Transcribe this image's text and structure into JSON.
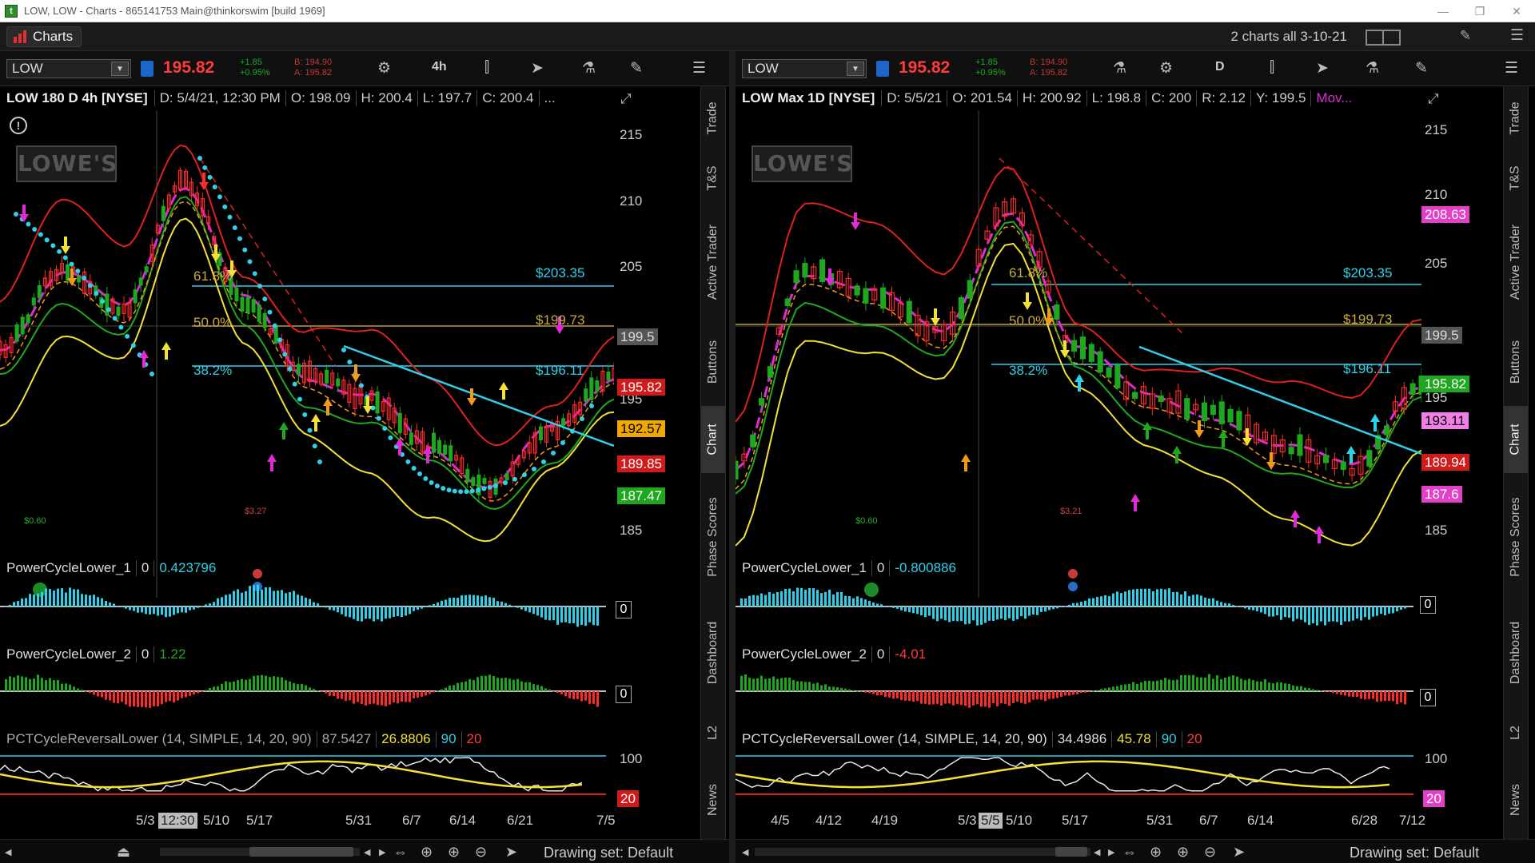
{
  "window": {
    "title": "LOW, LOW - Charts - 865141753 Main@thinkorswim [build 1969]",
    "minimize": "—",
    "restore": "❐",
    "close": "✕"
  },
  "app": {
    "tab_label": "Charts",
    "grid_title": "2 charts all 3-10-21",
    "pin_icon": "✎",
    "menu_icon": "☰"
  },
  "colors": {
    "bull": "#1fa81f",
    "bear": "#ff2a2a",
    "cyan": "#2fd0e8",
    "yellow": "#f3e133",
    "magenta": "#e02ad8",
    "orange": "#f39a1b",
    "fib": "#b8a13a"
  },
  "left": {
    "symbol": "LOW",
    "last_price": "195.82",
    "change_line1": "+1.85",
    "change_line2": "+0.95%",
    "bid": "B: 194.90",
    "ask": "A: 195.82",
    "aggregation": "4h",
    "header": {
      "name": "LOW 180 D 4h [NYSE]",
      "date": "D: 5/4/21, 12:30 PM",
      "open": "O: 198.09",
      "high": "H: 200.4",
      "low": "L: 197.7",
      "close": "C: 200.4",
      "more": "..."
    },
    "logo": "LOWE'S",
    "levels": [
      {
        "label": "$203.35",
        "color": "#2fd0e8"
      },
      {
        "label": "$199.73",
        "color": "#c9a93e"
      },
      {
        "label": "$196.11",
        "color": "#2fd0e8"
      }
    ],
    "fib_labels": [
      "61.8%",
      "50.0%",
      "38.2%"
    ],
    "yticks": [
      "215",
      "210",
      "205",
      "195",
      "185"
    ],
    "price_labels": [
      {
        "text": "199.5",
        "bg": "#555555",
        "fg": "#dddddd"
      },
      {
        "text": "195.82",
        "bg": "#d11a1a",
        "fg": "#ffffff"
      },
      {
        "text": "192.57",
        "bg": "#f0a800",
        "fg": "#000000"
      },
      {
        "text": "189.85",
        "bg": "#d11a1a",
        "fg": "#ffffff"
      },
      {
        "text": "187.47",
        "bg": "#1fa81f",
        "fg": "#ffffff"
      }
    ],
    "small_labels": [
      "$0.60",
      "$3.27"
    ],
    "studies": [
      {
        "name": "PowerCycleLower_1",
        "v1": "0",
        "v2": "0.423796",
        "v2_color": "#2fd0e8"
      },
      {
        "name": "PowerCycleLower_2",
        "v1": "0",
        "v2": "1.22",
        "v2_color": "#1fa81f"
      }
    ],
    "pct": {
      "name": "PCTCycleReversalLower (14, SIMPLE, 14, 20, 90)",
      "v1": "87.5427",
      "v2": "26.8806",
      "v3": "90",
      "v4": "20"
    },
    "pct_ticks": [
      "100",
      "20"
    ],
    "zero_label": "0",
    "xlabels": [
      "5/3",
      "5/10",
      "5/17",
      "5/31",
      "6/7",
      "6/14",
      "6/21",
      "7/5"
    ],
    "x_cursor": "12:30",
    "drawing_set": "Drawing set: Default"
  },
  "right": {
    "symbol": "LOW",
    "last_price": "195.82",
    "change_line1": "+1.85",
    "change_line2": "+0.95%",
    "bid": "B: 194.90",
    "ask": "A: 195.82",
    "aggregation": "D",
    "header": {
      "name": "LOW Max 1D [NYSE]",
      "date": "D: 5/5/21",
      "open": "O: 201.54",
      "high": "H: 200.92",
      "low": "L: 198.8",
      "close": "C: 200",
      "range": "R: 2.12",
      "y": "Y: 199.5",
      "mov": "Mov..."
    },
    "logo": "LOWE'S",
    "levels": [
      {
        "label": "$203.35",
        "color": "#2fd0e8"
      },
      {
        "label": "$199.73",
        "color": "#c9a93e"
      },
      {
        "label": "$196.11",
        "color": "#2fd0e8"
      }
    ],
    "fib_labels": [
      "61.8%",
      "50.0%",
      "38.2%"
    ],
    "yticks": [
      "215",
      "210",
      "205",
      "195",
      "185"
    ],
    "price_labels": [
      {
        "text": "208.63",
        "bg": "#e43fc9",
        "fg": "#ffffff"
      },
      {
        "text": "199.5",
        "bg": "#555555",
        "fg": "#dddddd"
      },
      {
        "text": "195.82",
        "bg": "#1fa81f",
        "fg": "#ffffff"
      },
      {
        "text": "193.11",
        "bg": "#f27fe8",
        "fg": "#000000"
      },
      {
        "text": "189.94",
        "bg": "#d11a1a",
        "fg": "#ffffff"
      },
      {
        "text": "187.6",
        "bg": "#e43fc9",
        "fg": "#ffffff"
      }
    ],
    "small_labels": [
      "$0.60",
      "$3.21"
    ],
    "studies": [
      {
        "name": "PowerCycleLower_1",
        "v1": "0",
        "v2": "-0.800886",
        "v2_color": "#2fd0e8"
      },
      {
        "name": "PowerCycleLower_2",
        "v1": "0",
        "v2": "-4.01",
        "v2_color": "#ff3b3b"
      }
    ],
    "pct": {
      "name": "PCTCycleReversalLower (14, SIMPLE, 14, 20, 90)",
      "v1": "34.4986",
      "v2": "45.78",
      "v3": "90",
      "v4": "20"
    },
    "pct_ticks": [
      "100",
      "20"
    ],
    "zero_label": "0",
    "xlabels": [
      "4/5",
      "4/12",
      "4/19",
      "5/3",
      "5/10",
      "5/17",
      "5/31",
      "6/7",
      "6/14",
      "6/28",
      "7/12"
    ],
    "x_cursor": "5/5",
    "drawing_set": "Drawing set: Default"
  },
  "side_tabs": [
    "Trade",
    "T&S",
    "Active Trader",
    "Buttons",
    "Chart",
    "Phase Scores",
    "Dashboard",
    "L2",
    "News"
  ]
}
